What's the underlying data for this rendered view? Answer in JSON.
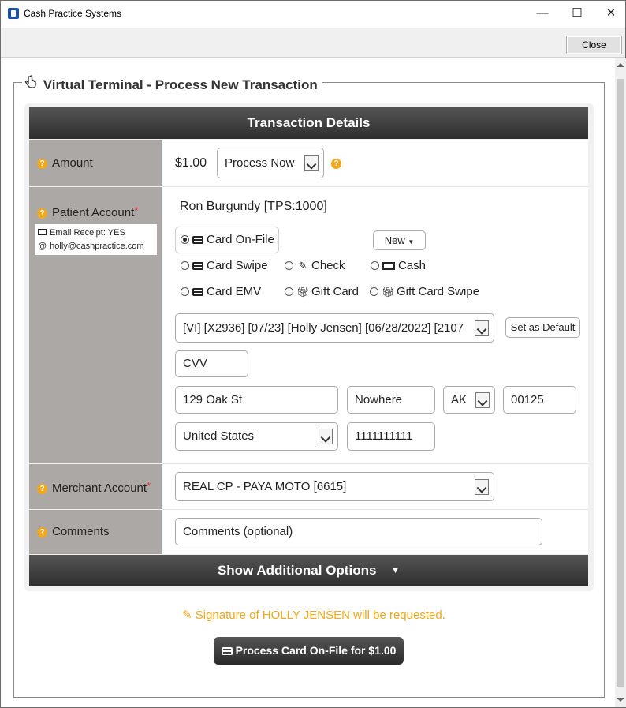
{
  "window": {
    "title": "Cash Practice Systems",
    "minimize": "—",
    "maximize": "☐",
    "close": "✕"
  },
  "toolbar": {
    "close_label": "Close"
  },
  "legend": {
    "title": "Virtual Terminal - Process New Transaction"
  },
  "section": {
    "header": "Transaction Details"
  },
  "amount": {
    "label": "Amount",
    "value": "$1.00",
    "mode": "Process Now"
  },
  "patient": {
    "label": "Patient Account",
    "required_mark": "*",
    "name": "Ron Burgundy [TPS:1000]",
    "email_receipt": "Email Receipt: YES",
    "email": "holly@cashpractice.com"
  },
  "payment": {
    "options": [
      {
        "label": "Card On-File",
        "selected": true
      },
      {
        "label": "Card Swipe",
        "selected": false
      },
      {
        "label": "Check",
        "selected": false
      },
      {
        "label": "Cash",
        "selected": false
      },
      {
        "label": "Card EMV",
        "selected": false
      },
      {
        "label": "Gift Card",
        "selected": false
      },
      {
        "label": "Gift Card Swipe",
        "selected": false
      }
    ],
    "new_label": "New",
    "card_select": "[VI] [X2936] [07/23] [Holly Jensen] [06/28/2022] [2107",
    "set_default": "Set as Default",
    "cvv_placeholder": "CVV",
    "address": "129 Oak St",
    "city": "Nowhere",
    "state": "AK",
    "zip": "00125",
    "country": "United States",
    "phone": "1111111111"
  },
  "merchant": {
    "label": "Merchant Account",
    "required_mark": "*",
    "value": "REAL CP - PAYA MOTO [6615]"
  },
  "comments": {
    "label": "Comments",
    "placeholder": "Comments (optional)"
  },
  "options_bar": {
    "label": "Show Additional Options",
    "caret": "▼"
  },
  "signature": {
    "text": "Signature of HOLLY JENSEN will be requested."
  },
  "process": {
    "label": "Process Card On-File for $1.00"
  },
  "colors": {
    "accent": "#f0a81c",
    "header": "#3a3a3a",
    "label_bg": "#aca8a6"
  }
}
